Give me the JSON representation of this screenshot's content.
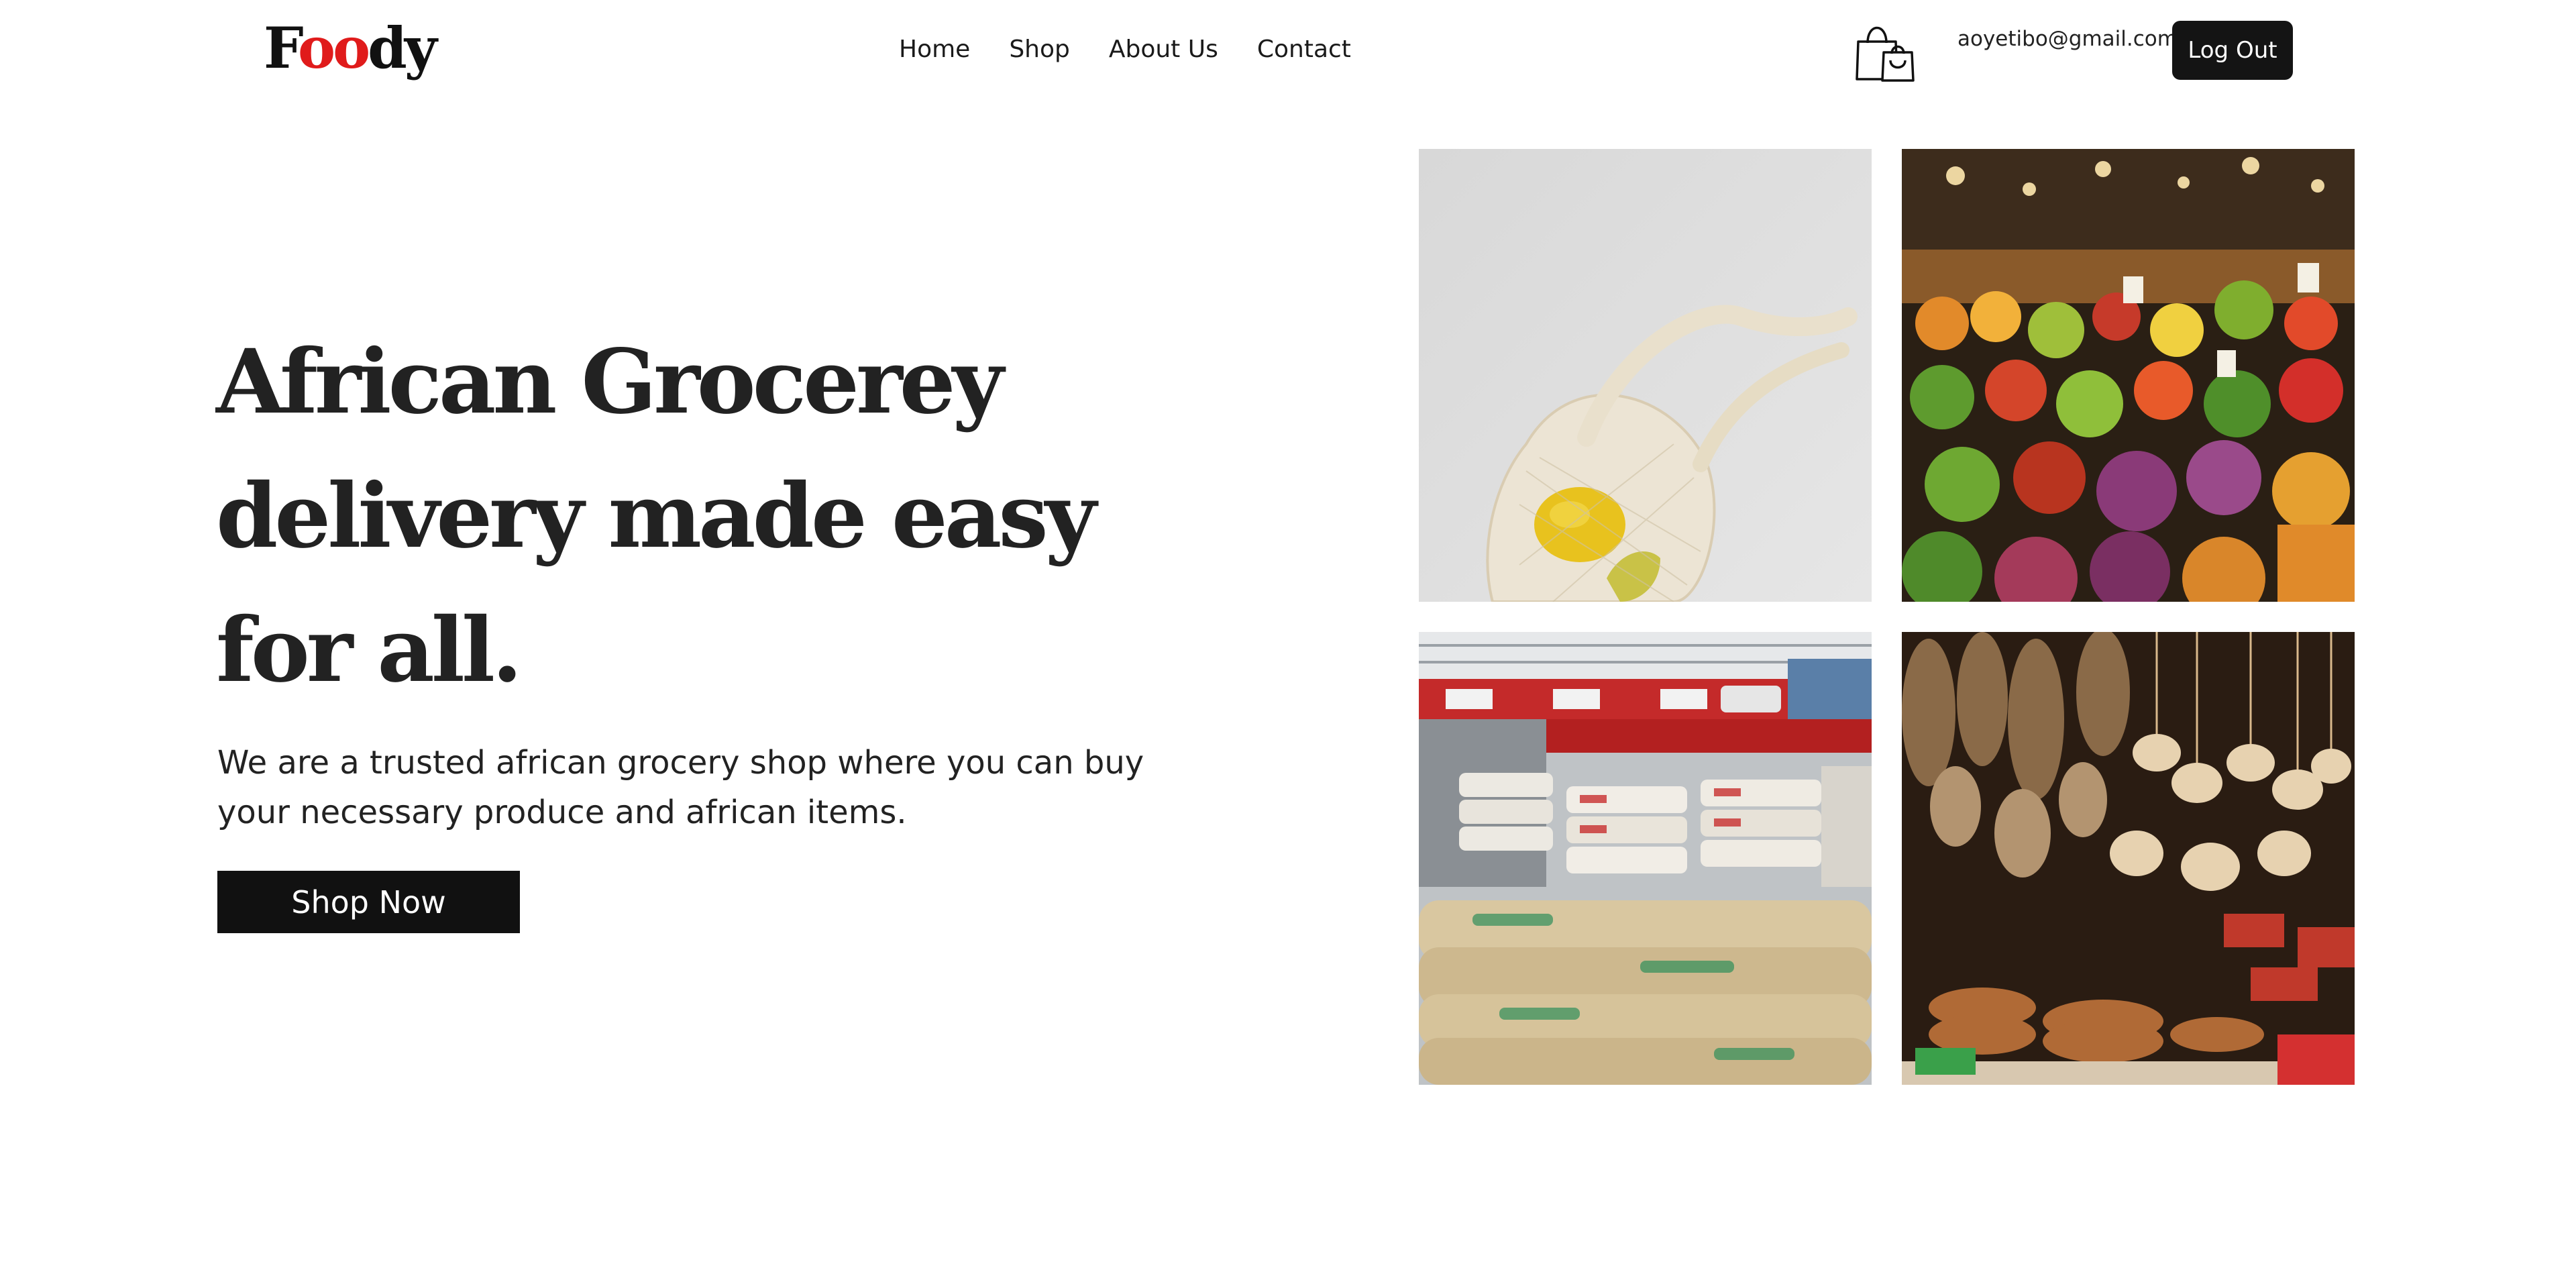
{
  "brand": {
    "part1": "F",
    "part2": "oo",
    "part3": "dy",
    "accent_color": "#e01b1b"
  },
  "nav": {
    "links": [
      {
        "label": "Home"
      },
      {
        "label": "Shop"
      },
      {
        "label": "About Us"
      },
      {
        "label": "Contact"
      }
    ]
  },
  "header": {
    "cart_icon": "shopping-bag-icon",
    "user_email": "aoyetibo@gmail.com",
    "logout_label": "Log Out"
  },
  "hero": {
    "title": "African Grocerey delivery made easy for all.",
    "description": "We are a trusted african grocery shop where you can buy your necessary produce and african items.",
    "cta_label": "Shop Now"
  },
  "gallery": {
    "images": [
      {
        "name": "mesh-bag-lemon-image"
      },
      {
        "name": "produce-market-image"
      },
      {
        "name": "rice-sacks-store-image"
      },
      {
        "name": "handicraft-market-image"
      }
    ]
  },
  "colors": {
    "primary_dark": "#111111",
    "background": "#ffffff",
    "text": "#222222"
  }
}
